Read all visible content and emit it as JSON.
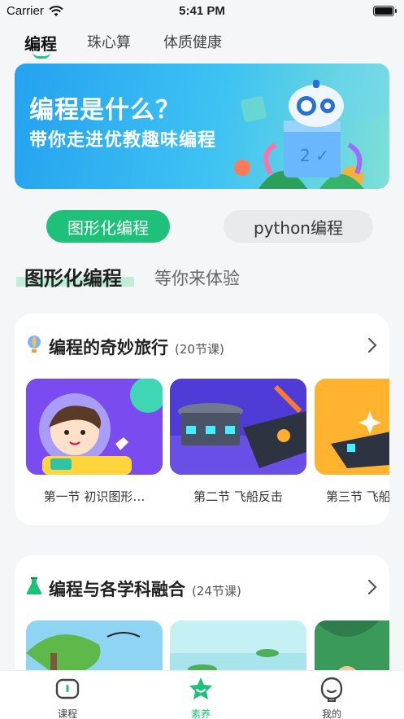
{
  "status_bar": {
    "carrier": "Carrier",
    "time": "5:41 PM"
  },
  "top_tabs": [
    {
      "label": "编程",
      "active": true
    },
    {
      "label": "珠心算",
      "active": false
    },
    {
      "label": "体质健康",
      "active": false
    }
  ],
  "banner": {
    "title": "编程是什么？",
    "subtitle": "带你走进优教趣味编程"
  },
  "segments": {
    "active": "图形化编程",
    "inactive": "python编程"
  },
  "section": {
    "title": "图形化编程",
    "subtitle": "等你来体验"
  },
  "course1": {
    "title": "编程的奇妙旅行",
    "count": "(20节课)",
    "icon": "hot-air-balloon-icon",
    "lessons": [
      {
        "label": "第一节 初识图形…"
      },
      {
        "label": "第二节 飞船反击"
      },
      {
        "label": "第三节 飞船"
      }
    ]
  },
  "course2": {
    "title": "编程与各学科融合",
    "count": "(24节课)",
    "icon": "flask-icon"
  },
  "bottom_nav": [
    {
      "label": "课程",
      "icon": "book-icon",
      "active": false
    },
    {
      "label": "素养",
      "icon": "star-icon",
      "active": true
    },
    {
      "label": "我的",
      "icon": "profile-icon",
      "active": false
    }
  ],
  "colors": {
    "accent": "#1ec07a",
    "banner": "#24a2f0"
  }
}
